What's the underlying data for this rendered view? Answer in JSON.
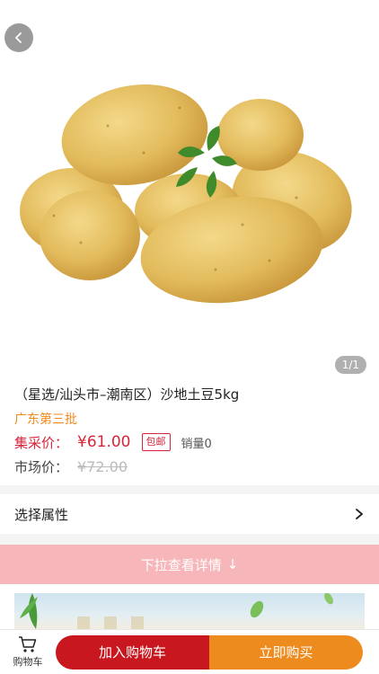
{
  "product": {
    "title": "（星选/汕头市–潮南区）沙地土豆5kg",
    "origin": "广东第三批",
    "image_counter": "1/1"
  },
  "pricing": {
    "group_price_label": "集采价：",
    "group_price": "¥61.00",
    "free_shipping_badge": "包邮",
    "sales": "销量0",
    "market_price_label": "市场价：",
    "market_price": "¥72.00"
  },
  "attributes": {
    "label": "选择属性"
  },
  "details": {
    "pull_hint": "下拉查看详情",
    "pull_arrow": "↓"
  },
  "bottom_bar": {
    "cart_label": "购物车",
    "add_to_cart": "加入购物车",
    "buy_now": "立即购买"
  },
  "colors": {
    "price_red": "#d6243a",
    "origin_orange": "#f08a1c",
    "cart_button": "#c8171f",
    "buy_button": "#ee8b1f",
    "pull_bar": "#f7b6ba"
  },
  "icons": [
    "back-icon",
    "chevron-right-icon",
    "cart-icon",
    "down-arrow-icon"
  ]
}
